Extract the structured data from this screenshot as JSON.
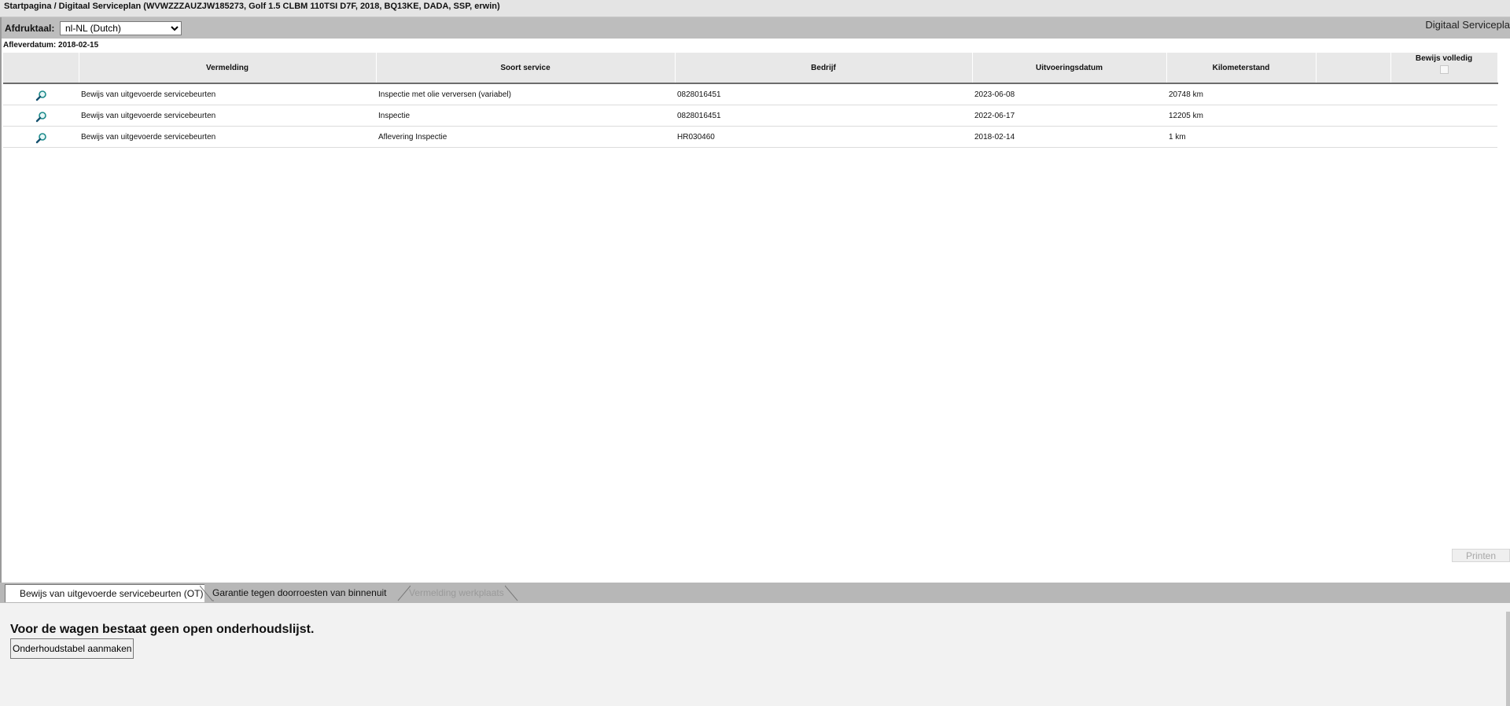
{
  "breadcrumb": "Startpagina / Digitaal Serviceplan (WVWZZZAUZJW185273, Golf 1.5 CLBM 110TSI D7F, 2018, BQ13KE, DADA, SSP, erwin)",
  "toolbar": {
    "language_label": "Afdruktaal:",
    "language_value": "nl-NL (Dutch)",
    "app_title": "Digitaal Servicepla"
  },
  "delivery_date": "Afleverdatum: 2018-02-15",
  "table": {
    "headers": {
      "entry": "Vermelding",
      "service_type": "Soort service",
      "company": "Bedrijf",
      "execution_date": "Uitvoeringsdatum",
      "mileage": "Kilometerstand",
      "blank": "",
      "proof_complete": "Bewijs volledig"
    },
    "rows": [
      {
        "entry": "Bewijs van uitgevoerde servicebeurten",
        "service_type": "Inspectie met olie verversen (variabel)",
        "company": "0828016451",
        "execution_date": "2023-06-08",
        "mileage": "20748 km"
      },
      {
        "entry": "Bewijs van uitgevoerde servicebeurten",
        "service_type": "Inspectie",
        "company": "0828016451",
        "execution_date": "2022-06-17",
        "mileage": "12205 km"
      },
      {
        "entry": "Bewijs van uitgevoerde servicebeurten",
        "service_type": "Aflevering Inspectie",
        "company": "HR030460",
        "execution_date": "2018-02-14",
        "mileage": "1 km"
      }
    ]
  },
  "print_button": "Printen",
  "tabs": [
    {
      "label": "Bewijs van uitgevoerde servicebeurten (OT)"
    },
    {
      "label": "Garantie tegen doorroesten van binnenuit"
    },
    {
      "label": "Vermelding werkplaats"
    }
  ],
  "bottom": {
    "message": "Voor de wagen bestaat geen open onderhoudslijst.",
    "create_button": "Onderhoudstabel aanmaken"
  },
  "colors": {
    "toolbar": "#bdbdbd",
    "header_bg": "#e8e8e8",
    "zoom_icon": "#1a8a8a"
  },
  "icons": [
    "magnifier-icon"
  ]
}
